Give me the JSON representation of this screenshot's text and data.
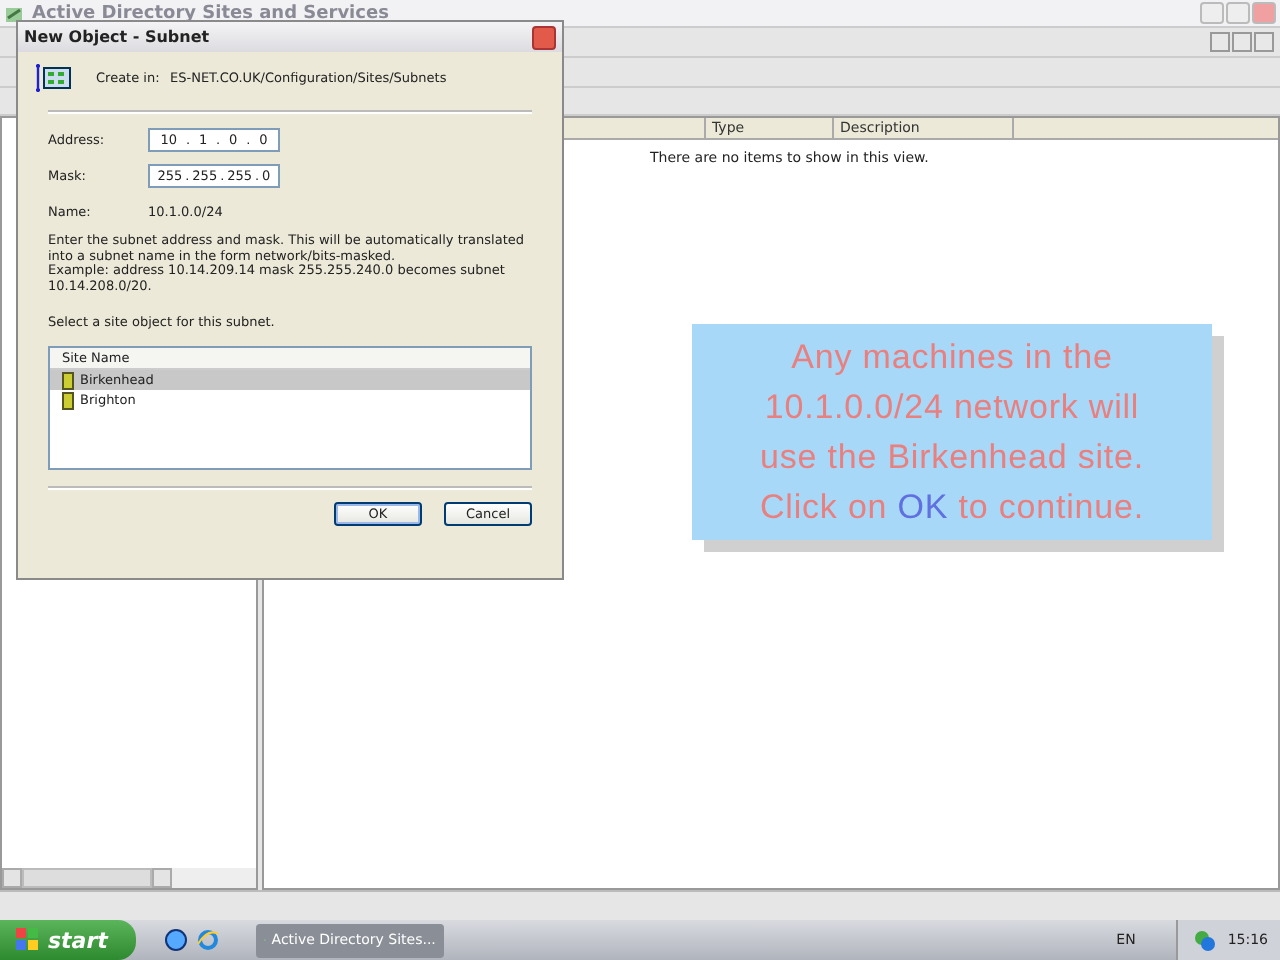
{
  "app": {
    "title": "Active Directory Sites and Services",
    "list": {
      "columns": [
        "Type",
        "Description"
      ],
      "empty_message": "There are no items to show in this view."
    }
  },
  "dialog": {
    "title": "New Object - Subnet",
    "create_in_label": "Create in:",
    "create_in_path": "ES-NET.CO.UK/Configuration/Sites/Subnets",
    "address": {
      "label": "Address:",
      "octets": [
        "10",
        "1",
        "0",
        "0"
      ],
      "separator": "."
    },
    "mask": {
      "label": "Mask:",
      "octets": [
        "255",
        "255",
        "255",
        "0"
      ],
      "separator": "."
    },
    "name": {
      "label": "Name:",
      "value": "10.1.0.0/24"
    },
    "help": [
      "Enter the subnet address and mask. This will be automatically translated into a subnet name in the form network/bits-masked.",
      "Example: address 10.14.209.14 mask 255.255.240.0 becomes subnet 10.14.208.0/20."
    ],
    "site_prompt": "Select a site object for this subnet.",
    "site_list": {
      "column": "Site Name",
      "items": [
        {
          "name": "Birkenhead",
          "selected": true
        },
        {
          "name": "Brighton",
          "selected": false
        }
      ]
    },
    "buttons": [
      "OK",
      "Cancel"
    ]
  },
  "callout": {
    "text": "Any machines in the 10.1.0.0/24 network will use the Birkenhead site. Click on",
    "highlight": "OK",
    "text_after": "to continue."
  },
  "taskbar": {
    "start": "start",
    "tasks": [
      {
        "label": "Active Directory Sites...",
        "selected": false
      }
    ],
    "language": "EN",
    "clock": "15:16"
  }
}
